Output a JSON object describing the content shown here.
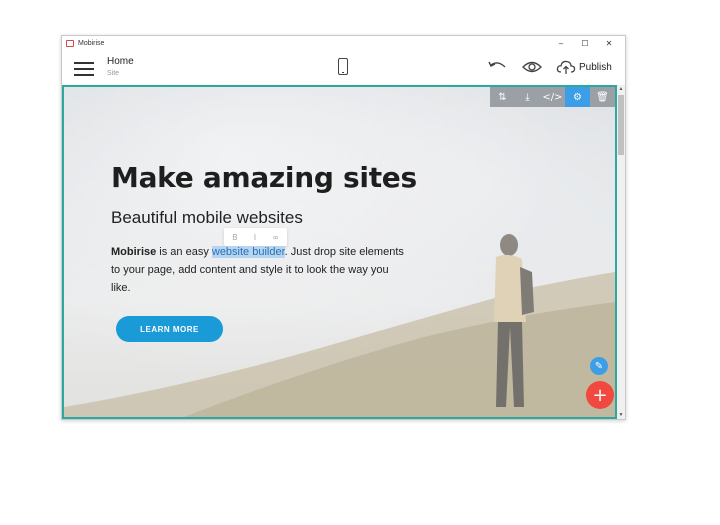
{
  "window": {
    "app_title": "Mobirise",
    "controls": {
      "minimize": "–",
      "maximize": "☐",
      "close": "✕"
    }
  },
  "topbar": {
    "page_name": "Home",
    "page_sub": "Site",
    "publish_label": "Publish"
  },
  "block_toolbar": {
    "items": [
      {
        "icon": "move-updown-icon",
        "glyph": "⇅"
      },
      {
        "icon": "download-icon",
        "glyph": "⤓"
      },
      {
        "icon": "code-icon",
        "glyph": "</>"
      },
      {
        "icon": "gear-icon",
        "glyph": "⚙"
      },
      {
        "icon": "trash-icon",
        "glyph": "🗑"
      }
    ]
  },
  "hero": {
    "title": "Make amazing sites",
    "subtitle": "Beautiful mobile websites",
    "text_strong": "Mobirise",
    "text_pre": " is an easy ",
    "text_selected": "website builder",
    "text_post": ". Just drop site elements to your page, add content and style it to look the way you like.",
    "button_label": "LEARN MORE"
  },
  "mini_toolbar": {
    "bold": "B",
    "italic": "I",
    "link": "∞"
  },
  "fab": {
    "pencil": "✎",
    "add": "+"
  },
  "colors": {
    "accent": "#2ba99f",
    "button": "#1a9bd7",
    "gear_active": "#3d9ee8",
    "add_fab": "#f1483f"
  }
}
